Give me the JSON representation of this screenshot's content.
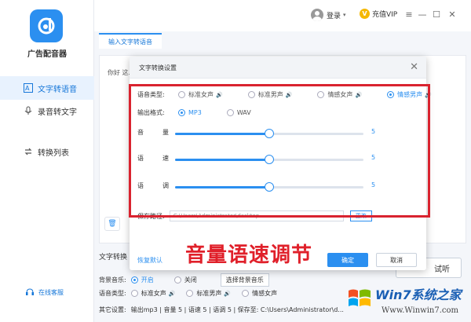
{
  "app": {
    "title": "广告配音器"
  },
  "header": {
    "login": "登录",
    "vip": "充值VIP"
  },
  "sidebar": {
    "items": [
      {
        "label": "文字转语音",
        "icon": "text-to-speech-icon",
        "active": true
      },
      {
        "label": "录音转文字",
        "icon": "microphone-icon",
        "active": false
      },
      {
        "label": "转换列表",
        "icon": "list-icon",
        "active": false
      }
    ],
    "support": "在线客服"
  },
  "tabs": [
    {
      "label": "输入文字转语音"
    }
  ],
  "editor": {
    "text": "你好 这..."
  },
  "lower": {
    "title": "文字转换",
    "listen": "试听",
    "bgm_label": "背景音乐:",
    "bgm_on": "开启",
    "bgm_off": "关闭",
    "bgm_select": "选择背景音乐",
    "voice_label": "语音类型:",
    "voice_options": [
      "标准女声",
      "标准男声",
      "情感女声"
    ],
    "other_label": "其它设置:",
    "other_text": "输出mp3 | 音量 5 | 语速 5 | 语调 5 | 保存至: C:\\Users\\Administrator\\d..."
  },
  "dialog": {
    "title": "文字转换设置",
    "voice_label": "语音类型:",
    "voice_options": [
      "标准女声",
      "标准男声",
      "情感女声",
      "情感男声"
    ],
    "voice_selected": 3,
    "format_label": "输出格式:",
    "formats": [
      "MP3",
      "WAV"
    ],
    "format_selected": 0,
    "sliders": [
      {
        "label_a": "音",
        "label_b": "量",
        "value": 5,
        "fraction": 0.5
      },
      {
        "label_a": "语",
        "label_b": "速",
        "value": 5,
        "fraction": 0.5
      },
      {
        "label_a": "语",
        "label_b": "调",
        "value": 5,
        "fraction": 0.5
      }
    ],
    "path_label": "保存路径:",
    "path_value": "C:\\Users\\Administrator\\desktop",
    "change": "更改",
    "reset": "恢复默认",
    "ok": "确定",
    "cancel": "取消"
  },
  "caption": "音量语速调节",
  "watermark": {
    "line1": "Win7系统之家",
    "line2": "Www.Winwin7.com"
  },
  "colors": {
    "accent": "#2b8ff0",
    "highlight": "#d9232f"
  }
}
